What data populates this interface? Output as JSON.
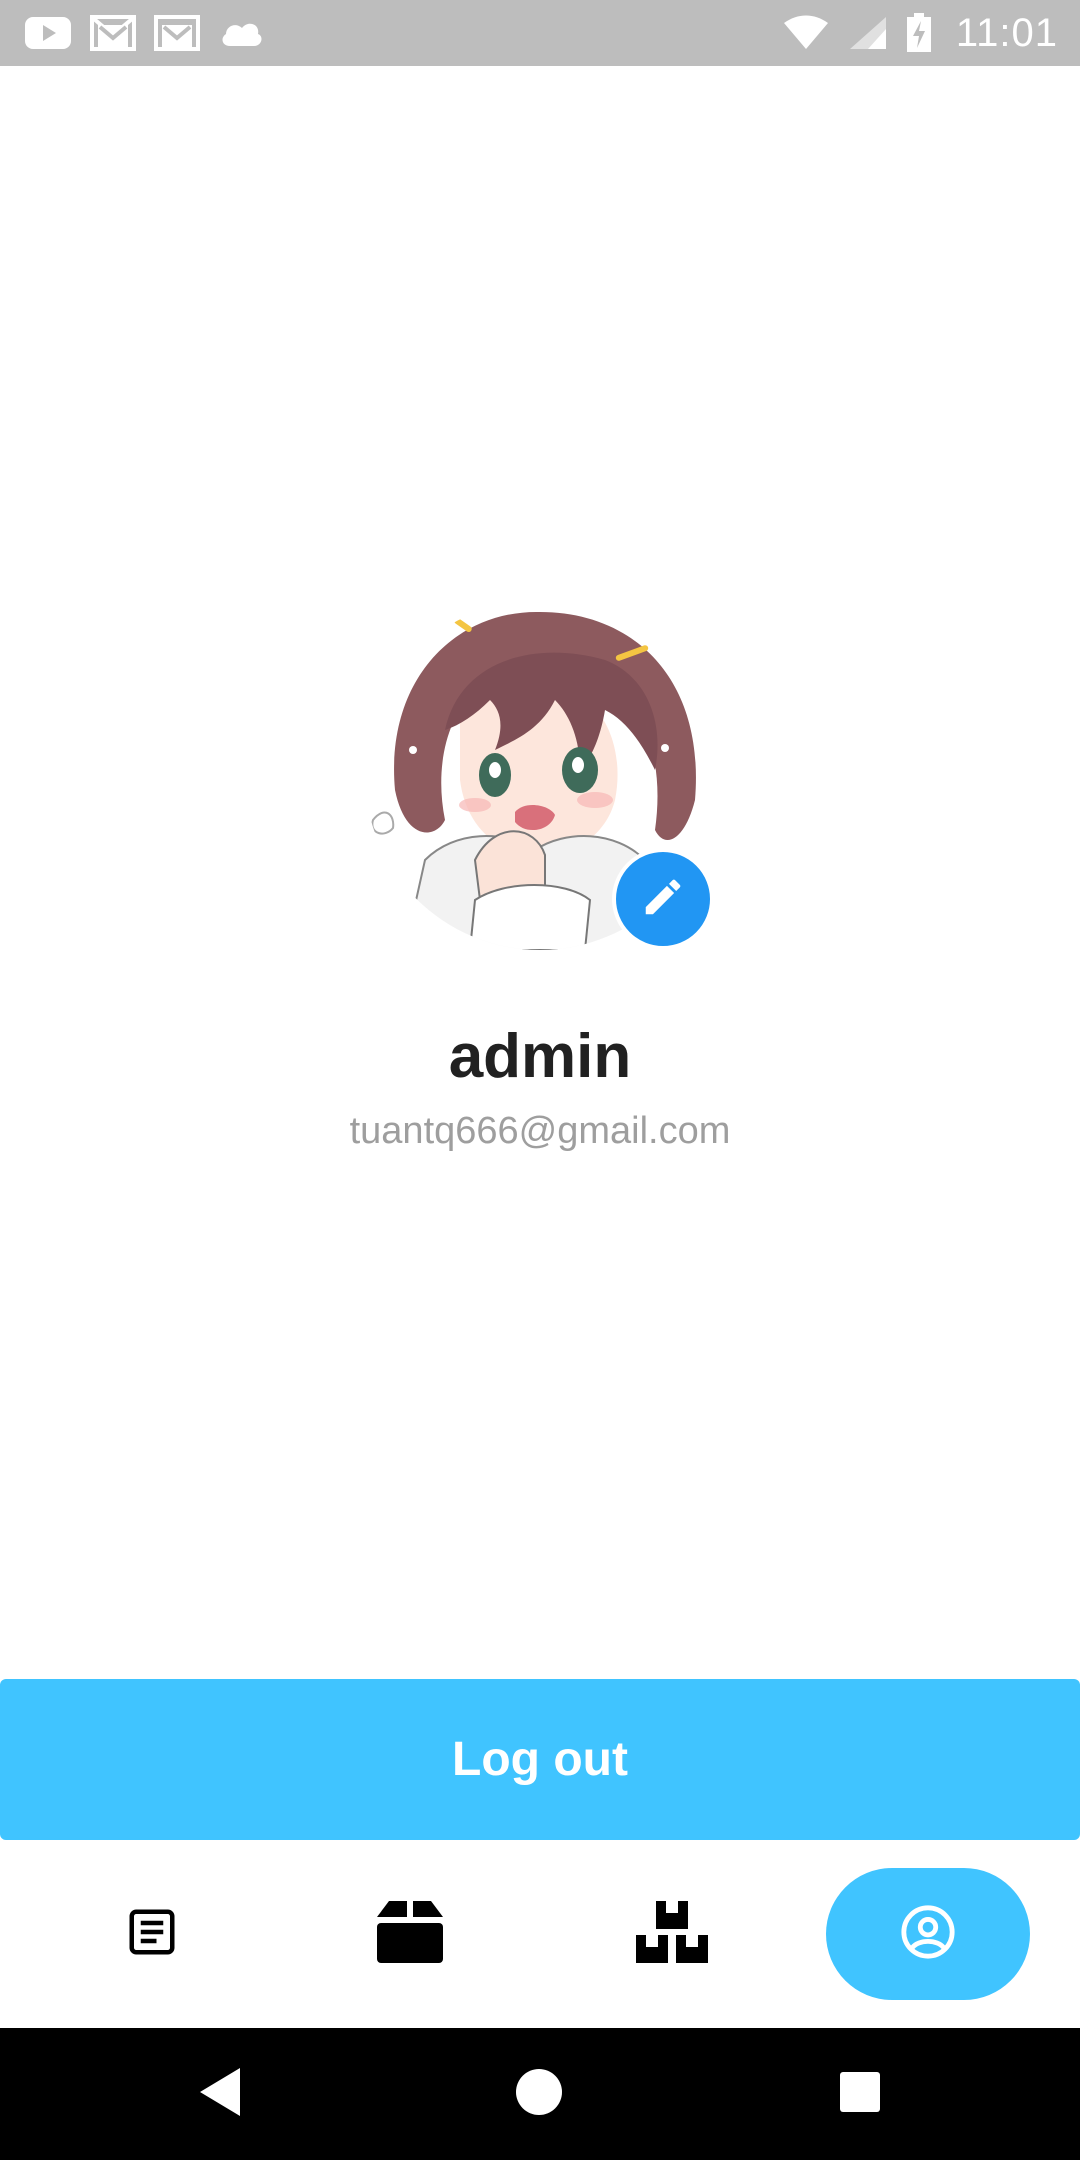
{
  "status_bar": {
    "time": "11:01",
    "left_icons": [
      "youtube-icon",
      "gmail-icon",
      "gmail-icon",
      "cloud-icon"
    ],
    "right_icons": [
      "wifi-icon",
      "signal-icon",
      "battery-charging-icon"
    ]
  },
  "profile": {
    "username": "admin",
    "email": "tuantq666@gmail.com",
    "avatar_icon": "anime-avatar",
    "edit_icon": "pencil-icon"
  },
  "actions": {
    "logout_label": "Log out"
  },
  "bottom_nav": {
    "items": [
      {
        "icon": "article-icon",
        "active": false
      },
      {
        "icon": "box-icon",
        "active": false
      },
      {
        "icon": "boxes-icon",
        "active": false
      },
      {
        "icon": "account-circle-icon",
        "active": true
      }
    ]
  },
  "system_nav": {
    "buttons": [
      "back-icon",
      "home-icon",
      "recents-icon"
    ]
  },
  "colors": {
    "status_bar": "#bdbdbd",
    "accent": "#40c4ff",
    "edit_button": "#2196f3",
    "username": "#212121",
    "email": "#9e9e9e"
  }
}
